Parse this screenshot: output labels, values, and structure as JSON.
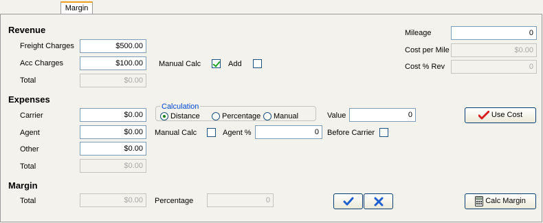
{
  "tab": {
    "label": "Margin"
  },
  "revenue": {
    "heading": "Revenue",
    "freight_label": "Freight Charges",
    "freight_value": "$500.00",
    "acc_label": "Acc Charges",
    "acc_value": "$100.00",
    "total_label": "Total",
    "total_value": "$0.00",
    "manual_calc_label": "Manual Calc",
    "manual_calc_checked": true,
    "add_label": "Add",
    "add_checked": false
  },
  "mileage": {
    "mileage_label": "Mileage",
    "mileage_value": "0",
    "cost_per_mile_label": "Cost per Mile",
    "cost_per_mile_value": "$0.00",
    "cost_rev_label": "Cost % Rev",
    "cost_rev_value": "0"
  },
  "expenses": {
    "heading": "Expenses",
    "carrier_label": "Carrier",
    "carrier_value": "$0.00",
    "agent_label": "Agent",
    "agent_value": "$0.00",
    "other_label": "Other",
    "other_value": "$0.00",
    "total_label": "Total",
    "total_value": "$0.00",
    "calc_group_label": "Calculation",
    "calc_options": [
      "Distance",
      "Percentage",
      "Manual"
    ],
    "calc_selected": "Distance",
    "value_label": "Value",
    "value_value": "0",
    "manual_calc_label": "Manual Calc",
    "agent_pct_label": "Agent %",
    "agent_pct_value": "0",
    "before_carrier_label": "Before Carrier",
    "use_cost_label": "Use Cost"
  },
  "margin": {
    "heading": "Margin",
    "total_label": "Total",
    "total_value": "$0.00",
    "percentage_label": "Percentage",
    "percentage_value": "0",
    "calc_margin_label": "Calc Margin"
  },
  "colors": {
    "accent": "#f0a020",
    "check_green": "#21a121",
    "cancel_blue": "#1d5fd0"
  }
}
